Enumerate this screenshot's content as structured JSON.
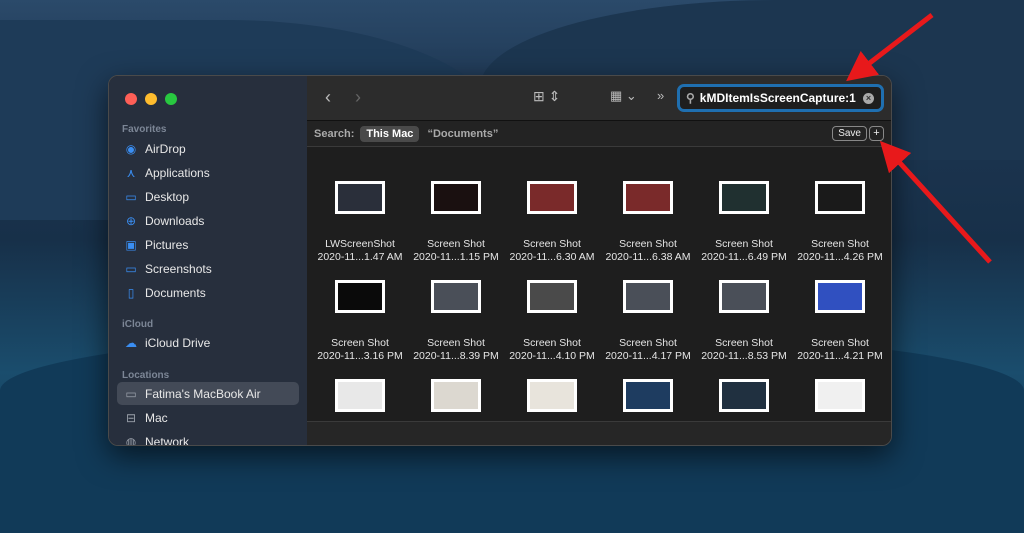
{
  "sidebar": {
    "favorites_label": "Favorites",
    "favorites": [
      {
        "label": "AirDrop",
        "icon": "airdrop-icon",
        "glyph": "◉"
      },
      {
        "label": "Applications",
        "icon": "applications-icon",
        "glyph": "⋏"
      },
      {
        "label": "Desktop",
        "icon": "desktop-icon",
        "glyph": "▭"
      },
      {
        "label": "Downloads",
        "icon": "downloads-icon",
        "glyph": "⊕"
      },
      {
        "label": "Pictures",
        "icon": "pictures-icon",
        "glyph": "▣"
      },
      {
        "label": "Screenshots",
        "icon": "folder-icon",
        "glyph": "▭"
      },
      {
        "label": "Documents",
        "icon": "document-icon",
        "glyph": "▯"
      }
    ],
    "icloud_label": "iCloud",
    "icloud": [
      {
        "label": "iCloud Drive",
        "icon": "cloud-icon",
        "glyph": "☁"
      }
    ],
    "locations_label": "Locations",
    "locations": [
      {
        "label": "Fatima's MacBook Air",
        "icon": "laptop-icon",
        "glyph": "▭"
      },
      {
        "label": "Mac",
        "icon": "drive-icon",
        "glyph": "⊟"
      },
      {
        "label": "Network",
        "icon": "network-icon",
        "glyph": "◍"
      }
    ]
  },
  "toolbar": {
    "search_value": "kMDItemIsScreenCapture:1"
  },
  "searchbar": {
    "label": "Search:",
    "scope_selected": "This Mac",
    "scope_other": "“Documents”",
    "save": "Save",
    "add": "+"
  },
  "files": [
    {
      "name": "LWScreenShot",
      "date": "2020-11...1.47 AM",
      "color": "#2a2f3a"
    },
    {
      "name": "Screen Shot",
      "date": "2020-11...1.15 PM",
      "color": "#1a1010"
    },
    {
      "name": "Screen Shot",
      "date": "2020-11...6.30 AM",
      "color": "#7a2a2a"
    },
    {
      "name": "Screen Shot",
      "date": "2020-11...6.38 AM",
      "color": "#7a2a2a"
    },
    {
      "name": "Screen Shot",
      "date": "2020-11...6.49 PM",
      "color": "#203030"
    },
    {
      "name": "Screen Shot",
      "date": "2020-11...4.26 PM",
      "color": "#1a1a1a"
    },
    {
      "name": "Screen Shot",
      "date": "2020-11...3.16 PM",
      "color": "#0a0a0a"
    },
    {
      "name": "Screen Shot",
      "date": "2020-11...8.39 PM",
      "color": "#4a4f58"
    },
    {
      "name": "Screen Shot",
      "date": "2020-11...4.10 PM",
      "color": "#4a4a4a"
    },
    {
      "name": "Screen Shot",
      "date": "2020-11...4.17 PM",
      "color": "#4a4f58"
    },
    {
      "name": "Screen Shot",
      "date": "2020-11...8.53 PM",
      "color": "#4a4f58"
    },
    {
      "name": "Screen Shot",
      "date": "2020-11...4.21 PM",
      "color": "#3050c0"
    },
    {
      "name": "",
      "date": "",
      "color": "#e8e8e8"
    },
    {
      "name": "",
      "date": "",
      "color": "#dcd8d0"
    },
    {
      "name": "",
      "date": "",
      "color": "#e8e4dc"
    },
    {
      "name": "",
      "date": "",
      "color": "#1e3c60"
    },
    {
      "name": "",
      "date": "",
      "color": "#203040"
    },
    {
      "name": "",
      "date": "",
      "color": "#f0f0f0"
    }
  ]
}
